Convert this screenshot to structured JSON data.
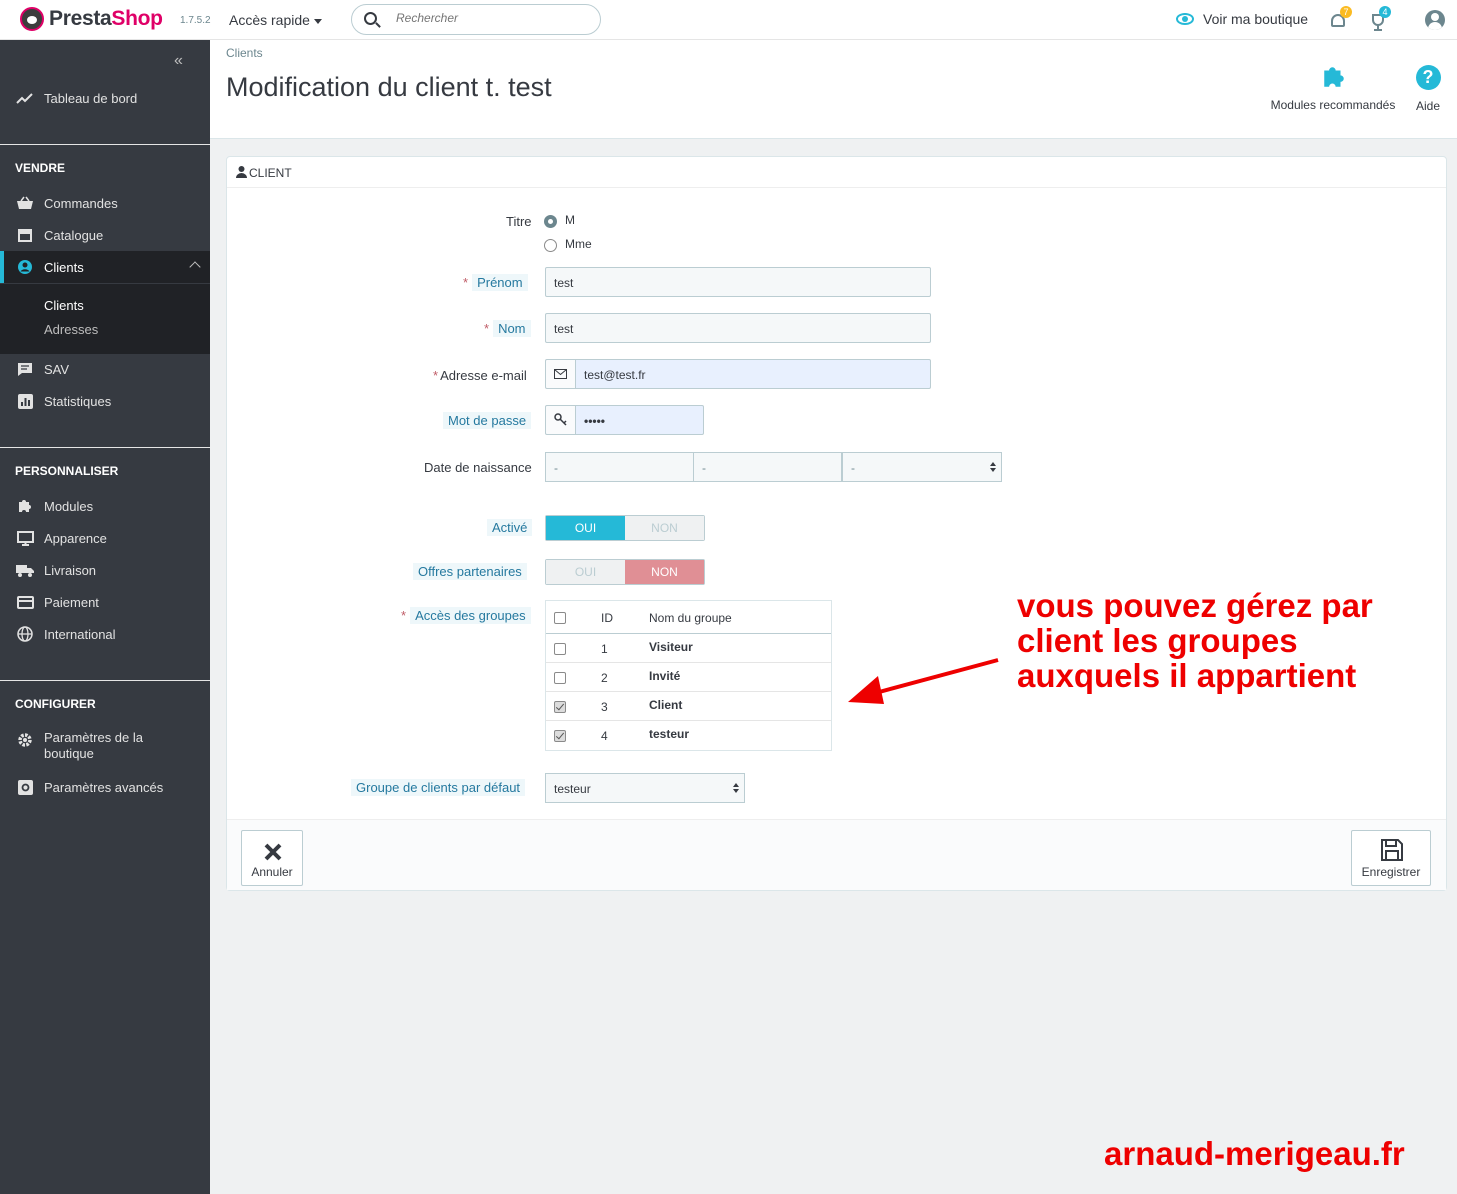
{
  "topbar": {
    "logo_part1": "Presta",
    "logo_part2": "Shop",
    "version": "1.7.5.2",
    "quick_access": "Accès rapide",
    "search_placeholder": "Rechercher",
    "view_shop": "Voir ma boutique",
    "notif_orders_count": "7",
    "notif_customers_count": "4",
    "accent": "#25b9d7",
    "brand": "#df0067"
  },
  "sidebar": {
    "collapse_icon": "«",
    "dashboard": "Tableau de bord",
    "section_sell": "VENDRE",
    "orders": "Commandes",
    "catalog": "Catalogue",
    "customers": "Clients",
    "sub_customers": "Clients",
    "sub_addresses": "Adresses",
    "support": "SAV",
    "stats": "Statistiques",
    "section_customize": "PERSONNALISER",
    "modules": "Modules",
    "appearance": "Apparence",
    "shipping": "Livraison",
    "payment": "Paiement",
    "international": "International",
    "section_configure": "CONFIGURER",
    "shop_params_line1": "Paramètres de la",
    "shop_params_line2": "boutique",
    "advanced_params": "Paramètres avancés"
  },
  "header": {
    "breadcrumb": "Clients",
    "title": "Modification du client t. test",
    "recommended_modules": "Modules recommandés",
    "help": "Aide"
  },
  "panel": {
    "title": "Client",
    "title_label": "Titre",
    "title_options": [
      "M",
      "Mme"
    ],
    "title_selected": "M",
    "firstname_label": "Prénom",
    "firstname_value": "test",
    "lastname_label": "Nom",
    "lastname_value": "test",
    "email_label": "Adresse e-mail",
    "email_value": "test@test.fr",
    "password_label": "Mot de passe",
    "password_value": "•••••",
    "birthday_label": "Date de naissance",
    "birthday_day": "-",
    "birthday_month": "-",
    "birthday_year": "-",
    "active_label": "Activé",
    "active_yes": "OUI",
    "active_no": "NON",
    "active_value": "OUI",
    "newsletter_label": "Offres partenaires",
    "newsletter_yes": "OUI",
    "newsletter_no": "NON",
    "newsletter_value": "NON",
    "groups_label": "Accès des groupes",
    "groups_header_id": "ID",
    "groups_header_name": "Nom du groupe",
    "groups": [
      {
        "id": "1",
        "name": "Visiteur",
        "checked": false
      },
      {
        "id": "2",
        "name": "Invité",
        "checked": false
      },
      {
        "id": "3",
        "name": "Client",
        "checked": true
      },
      {
        "id": "4",
        "name": "testeur",
        "checked": true
      }
    ],
    "default_group_label": "Groupe de clients par défaut",
    "default_group_value": "testeur",
    "cancel": "Annuler",
    "save": "Enregistrer"
  },
  "annotation": {
    "line1": "vous pouvez gérez par",
    "line2": "client les groupes",
    "line3": "auxquels il appartient",
    "color": "#ee0000"
  },
  "watermark": "arnaud-merigeau.fr"
}
